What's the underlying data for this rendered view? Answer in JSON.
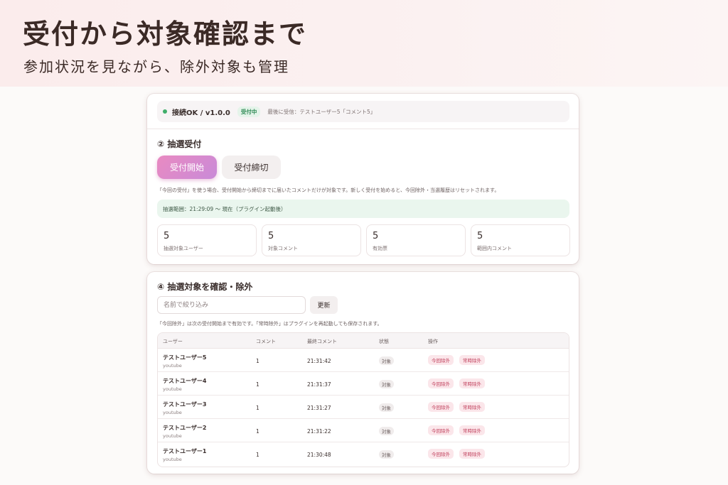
{
  "hero": {
    "title": "受付から対象確認まで",
    "subtitle": "参加状況を見ながら、除外対象も管理"
  },
  "status": {
    "connection": "接続OK / v1.0.0",
    "badge": "受付中",
    "last_received": "最後に受信：テストユーザー5「コメント5」",
    "dot_color": "#3fae6a"
  },
  "reception": {
    "title": "② 抽選受付",
    "start_button": "受付開始",
    "close_button": "受付締切",
    "note": "「今回の受付」を使う場合、受付開始から締切までに届いたコメントだけが対象です。新しく受付を始めると、今回除外・当選履歴はリセットされます。",
    "range": "抽選範囲：21:29:09 〜 現在（プラグイン起動後）",
    "stats": [
      {
        "value": "5",
        "label": "抽選対象ユーザー"
      },
      {
        "value": "5",
        "label": "対象コメント"
      },
      {
        "value": "5",
        "label": "有効票"
      },
      {
        "value": "5",
        "label": "範囲内コメント"
      }
    ]
  },
  "targets": {
    "title": "④ 抽選対象を確認・除外",
    "search_placeholder": "名前で絞り込み",
    "refresh_button": "更新",
    "note": "「今回除外」は次の受付開始まで有効です。「常時除外」はプラグインを再起動しても保存されます。",
    "columns": [
      "ユーザー",
      "コメント",
      "最終コメント",
      "状態",
      "操作"
    ],
    "rows": [
      {
        "user": "テストユーザー5",
        "source": "youtube",
        "comments": "1",
        "last": "21:31:42",
        "state": "対象",
        "op1": "今回除外",
        "op2": "常時除外"
      },
      {
        "user": "テストユーザー4",
        "source": "youtube",
        "comments": "1",
        "last": "21:31:37",
        "state": "対象",
        "op1": "今回除外",
        "op2": "常時除外"
      },
      {
        "user": "テストユーザー3",
        "source": "youtube",
        "comments": "1",
        "last": "21:31:27",
        "state": "対象",
        "op1": "今回除外",
        "op2": "常時除外"
      },
      {
        "user": "テストユーザー2",
        "source": "youtube",
        "comments": "1",
        "last": "21:31:22",
        "state": "対象",
        "op1": "今回除外",
        "op2": "常時除外"
      },
      {
        "user": "テストユーザー1",
        "source": "youtube",
        "comments": "1",
        "last": "21:30:48",
        "state": "対象",
        "op1": "今回除外",
        "op2": "常時除外"
      }
    ]
  },
  "colors": {
    "accent_gradient_start": "#e98ac1",
    "accent_gradient_end": "#c98ad8",
    "exclude_text": "#c0405c",
    "range_bg": "#eaf6ee"
  }
}
